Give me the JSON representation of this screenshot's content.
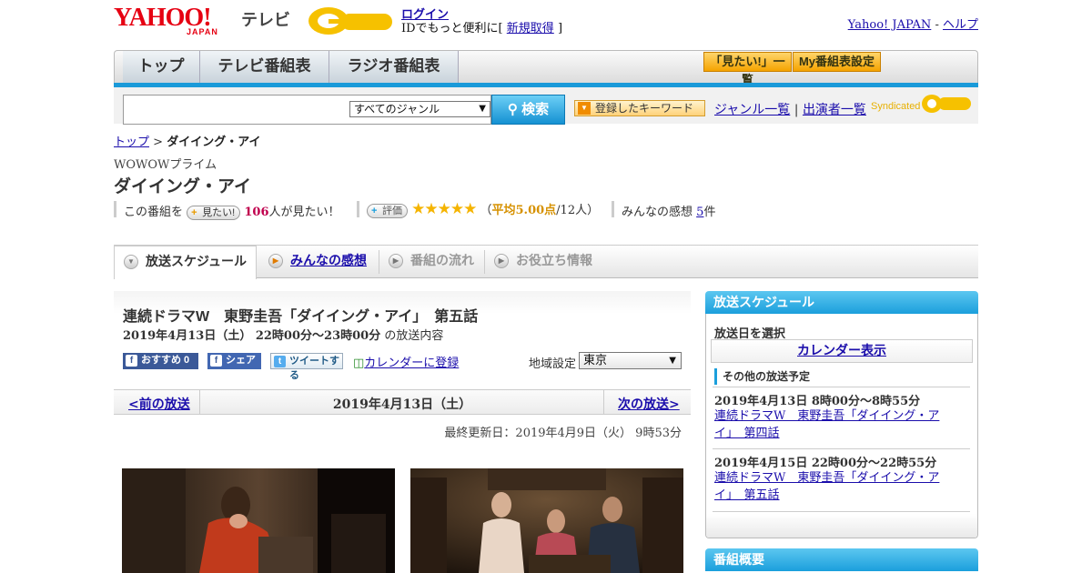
{
  "header": {
    "logo_main": "YAHOO!",
    "logo_sub": "JAPAN",
    "logo_tv": "テレビ",
    "login": "ログイン",
    "id_prefix": "IDでもっと便利に[",
    "register": "新規取得",
    "id_suffix": "]",
    "yahoo_japan": "Yahoo! JAPAN",
    "link_sep": "-",
    "help": "ヘルプ"
  },
  "nav": {
    "tabs": [
      "トップ",
      "テレビ番組表",
      "ラジオ番組表"
    ],
    "want_list": "「見たい!」一覧",
    "my_setting": "My番組表設定"
  },
  "search": {
    "genre": "すべてのジャンル",
    "button": "検索",
    "keyword_button": "登録したキーワード",
    "genre_list": "ジャンル一覧",
    "link_sep": "|",
    "cast_list": "出演者一覧",
    "syndicated": "Syndicated"
  },
  "breadcrumb": {
    "top": "トップ",
    "sep": ">",
    "current": "ダイイング・アイ"
  },
  "program": {
    "channel": "WOWOWプライム",
    "title": "ダイイング・アイ",
    "stats": {
      "prefix": "この番組を",
      "want_button": "見たい!",
      "want_count": "106",
      "want_suffix": "人が見たい！",
      "rating_button": "評価",
      "stars": "★★★★★",
      "avg_open": "（",
      "avg_label": "平均5.00点",
      "avg_count": "/12人）",
      "review_label": "みんなの感想",
      "review_count": "5",
      "review_suffix": "件"
    }
  },
  "tabs": {
    "schedule": "放送スケジュール",
    "reviews": "みんなの感想",
    "flow": "番組の流れ",
    "info": "お役立ち情報"
  },
  "episode": {
    "title": "連続ドラマW　東野圭吾「ダイイング・アイ」　第五話",
    "date": "2019年4月13日（土）  22時00分～23時00分",
    "date_suffix": "の放送内容",
    "recommend": "おすすめ 0",
    "share": "シェア",
    "tweet": "ツイートする",
    "calendar": "カレンダーに登録",
    "region_label": "地域設定",
    "region": "東京"
  },
  "pager": {
    "prev": "<前の放送",
    "date": "2019年4月13日（土）",
    "next": "次の放送>",
    "updated": "最終更新日：2019年4月9日（火）  9時53分"
  },
  "sidebar": {
    "schedule_head": "放送スケジュール",
    "select_date": "放送日を選択",
    "calendar_button": "カレンダー表示",
    "other_head": "その他の放送予定",
    "items": [
      {
        "date": "2019年4月13日  8時00分～8時55分",
        "title": "連続ドラマW　東野圭吾「ダイイング・アイ」　第四話"
      },
      {
        "date": "2019年4月15日  22時00分～22時55分",
        "title": "連続ドラマW　東野圭吾「ダイイング・アイ」　第五話"
      }
    ],
    "summary_head": "番組概要"
  },
  "colors": {
    "accent_blue": "#1b9fdc",
    "orange": "#f5a300",
    "star": "#f5b400",
    "link": "#1a0dab"
  }
}
